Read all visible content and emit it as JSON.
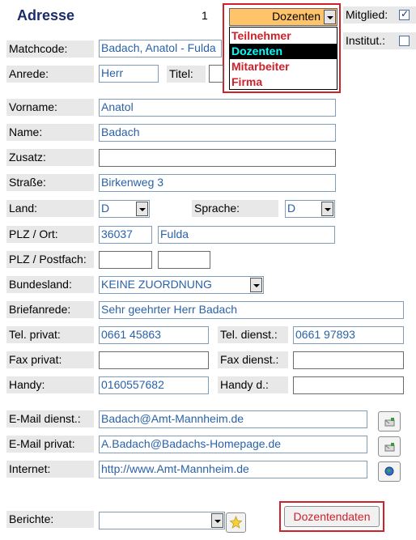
{
  "header": {
    "title": "Adresse",
    "record_no": "1",
    "category": {
      "selected": "Dozenten",
      "options": [
        "Teilnehmer",
        "Dozenten",
        "Mitarbeiter",
        "Firma"
      ]
    },
    "mitglied_label": "Mitglied:",
    "mitglied_checked": true,
    "institut_label": "Institut.:",
    "institut_checked": false
  },
  "form": {
    "matchcode": {
      "label": "Matchcode:",
      "value": "Badach, Anatol - Fulda"
    },
    "anrede": {
      "label": "Anrede:",
      "value": "Herr"
    },
    "titel": {
      "label": "Titel:",
      "value": ""
    },
    "vorname": {
      "label": "Vorname:",
      "value": "Anatol"
    },
    "name": {
      "label": "Name:",
      "value": "Badach"
    },
    "zusatz": {
      "label": "Zusatz:",
      "value": ""
    },
    "strasse": {
      "label": "Straße:",
      "value": "Birkenweg 3"
    },
    "land": {
      "label": "Land:",
      "value": "D"
    },
    "sprache": {
      "label": "Sprache:",
      "value": "D"
    },
    "plz_ort": {
      "label": "PLZ / Ort:",
      "plz": "36037",
      "ort": "Fulda"
    },
    "plz_postfach": {
      "label": "PLZ / Postfach:",
      "plz": "",
      "postfach": ""
    },
    "bundesland": {
      "label": "Bundesland:",
      "value": "KEINE ZUORDNUNG"
    },
    "briefanrede": {
      "label": "Briefanrede:",
      "value": "Sehr geehrter Herr Badach"
    },
    "tel_privat": {
      "label": "Tel. privat:",
      "value": "0661 45863"
    },
    "tel_dienst": {
      "label": "Tel. dienst.:",
      "value": "0661 97893"
    },
    "fax_privat": {
      "label": "Fax privat:",
      "value": ""
    },
    "fax_dienst": {
      "label": "Fax dienst.:",
      "value": ""
    },
    "handy": {
      "label": "Handy:",
      "value": "0160557682"
    },
    "handy_d": {
      "label": "Handy d.:",
      "value": ""
    },
    "email_dienst": {
      "label": "E-Mail dienst.:",
      "value": "Badach@Amt-Mannheim.de"
    },
    "email_privat": {
      "label": "E-Mail privat:",
      "value": "A.Badach@Badachs-Homepage.de"
    },
    "internet": {
      "label": "Internet:",
      "value": "http://www.Amt-Mannheim.de"
    },
    "berichte": {
      "label": "Berichte:",
      "value": ""
    }
  },
  "buttons": {
    "dozentendaten": "Dozentendaten"
  },
  "icons": {
    "email_dienst_btn": "send-mail-icon",
    "email_privat_btn": "send-mail-icon",
    "internet_btn": "globe-icon",
    "berichte_btn": "star-icon"
  },
  "colors": {
    "title": "#1a2d6b",
    "field_text": "#2a62a6",
    "highlight_red": "#d0202a",
    "dropdown_head": "#ffc36a",
    "selected_bg": "#000000",
    "selected_text": "#00ffff"
  }
}
